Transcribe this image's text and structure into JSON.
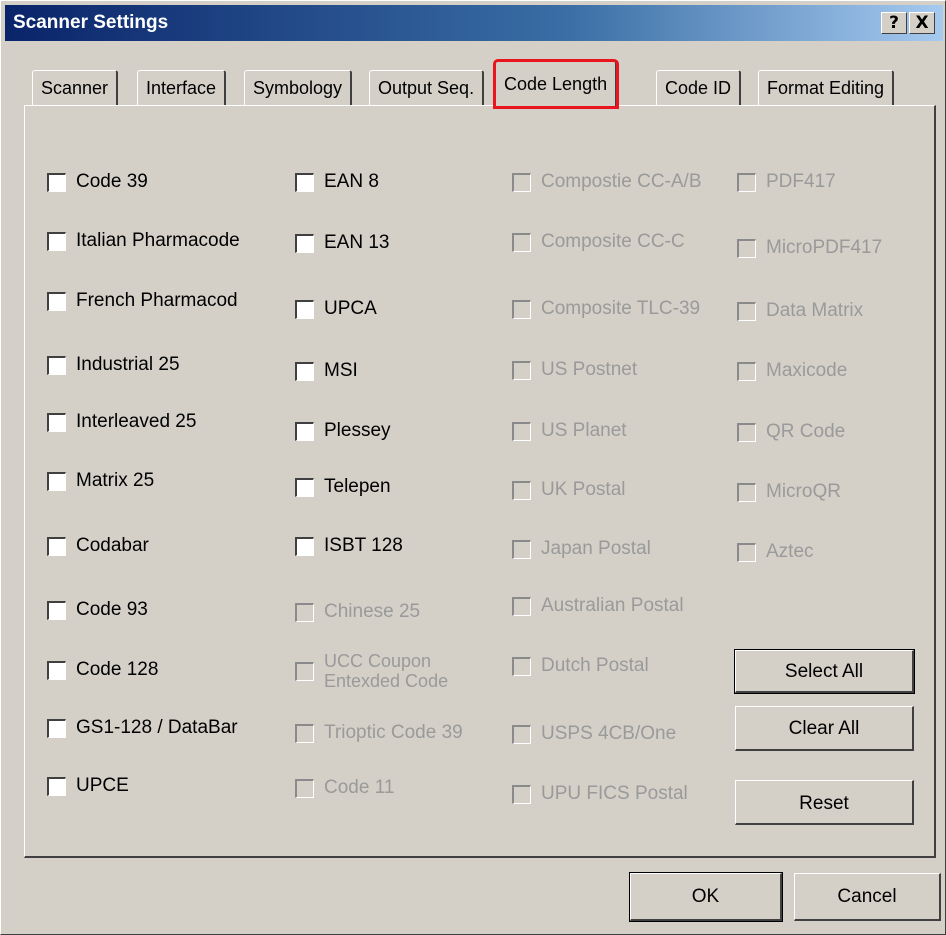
{
  "window": {
    "title": "Scanner Settings",
    "help_label": "?",
    "close_label": "X"
  },
  "tabs": [
    {
      "label": "Scanner"
    },
    {
      "label": "Interface"
    },
    {
      "label": "Symbology"
    },
    {
      "label": "Output Seq."
    },
    {
      "label": "Code Length",
      "active": true
    },
    {
      "label": "Code ID"
    },
    {
      "label": "Format Editing"
    }
  ],
  "columns": {
    "col1": [
      {
        "label": "Code 39",
        "checked": false,
        "enabled": true
      },
      {
        "label": "Italian Pharmacode",
        "checked": false,
        "enabled": true
      },
      {
        "label": "French Pharmacod",
        "checked": false,
        "enabled": true
      },
      {
        "label": "Industrial 25",
        "checked": false,
        "enabled": true
      },
      {
        "label": "Interleaved 25",
        "checked": false,
        "enabled": true
      },
      {
        "label": "Matrix 25",
        "checked": false,
        "enabled": true
      },
      {
        "label": "Codabar",
        "checked": false,
        "enabled": true
      },
      {
        "label": "Code 93",
        "checked": false,
        "enabled": true
      },
      {
        "label": "Code 128",
        "checked": false,
        "enabled": true
      },
      {
        "label": "GS1-128 / DataBar",
        "checked": false,
        "enabled": true
      },
      {
        "label": "UPCE",
        "checked": false,
        "enabled": true
      }
    ],
    "col2": [
      {
        "label": "EAN 8",
        "checked": false,
        "enabled": true
      },
      {
        "label": "EAN 13",
        "checked": false,
        "enabled": true
      },
      {
        "label": "UPCA",
        "checked": false,
        "enabled": true
      },
      {
        "label": "MSI",
        "checked": false,
        "enabled": true
      },
      {
        "label": "Plessey",
        "checked": false,
        "enabled": true
      },
      {
        "label": "Telepen",
        "checked": false,
        "enabled": true
      },
      {
        "label": "ISBT 128",
        "checked": false,
        "enabled": true
      },
      {
        "label": "Chinese 25",
        "checked": false,
        "enabled": false
      },
      {
        "label_line1": "UCC Coupon",
        "label_line2": "Entexded Code",
        "checked": false,
        "enabled": false
      },
      {
        "label": "Trioptic Code 39",
        "checked": false,
        "enabled": false
      },
      {
        "label": "Code 11",
        "checked": false,
        "enabled": false
      }
    ],
    "col3": [
      {
        "label": "Compostie CC-A/B",
        "checked": false,
        "enabled": false
      },
      {
        "label": "Composite CC-C",
        "checked": false,
        "enabled": false
      },
      {
        "label": "Composite TLC-39",
        "checked": false,
        "enabled": false
      },
      {
        "label": "US Postnet",
        "checked": false,
        "enabled": false
      },
      {
        "label": "US Planet",
        "checked": false,
        "enabled": false
      },
      {
        "label": "UK Postal",
        "checked": false,
        "enabled": false
      },
      {
        "label": "Japan Postal",
        "checked": false,
        "enabled": false
      },
      {
        "label": "Australian Postal",
        "checked": false,
        "enabled": false
      },
      {
        "label": "Dutch Postal",
        "checked": false,
        "enabled": false
      },
      {
        "label": "USPS 4CB/One",
        "checked": false,
        "enabled": false
      },
      {
        "label": "UPU FICS Postal",
        "checked": false,
        "enabled": false
      }
    ],
    "col4": [
      {
        "label": "PDF417",
        "checked": false,
        "enabled": false
      },
      {
        "label": "MicroPDF417",
        "checked": false,
        "enabled": false
      },
      {
        "label": "Data Matrix",
        "checked": false,
        "enabled": false
      },
      {
        "label": "Maxicode",
        "checked": false,
        "enabled": false
      },
      {
        "label": "QR Code",
        "checked": false,
        "enabled": false
      },
      {
        "label": "MicroQR",
        "checked": false,
        "enabled": false
      },
      {
        "label": "Aztec",
        "checked": false,
        "enabled": false
      }
    ]
  },
  "buttons": {
    "select_all": "Select All",
    "clear_all": "Clear All",
    "reset": "Reset",
    "ok": "OK",
    "cancel": "Cancel"
  },
  "colors": {
    "highlight": "#e8141e",
    "face": "#d4d0c8",
    "title_start": "#0a246a",
    "disabled_text": "#9a9a9a"
  }
}
